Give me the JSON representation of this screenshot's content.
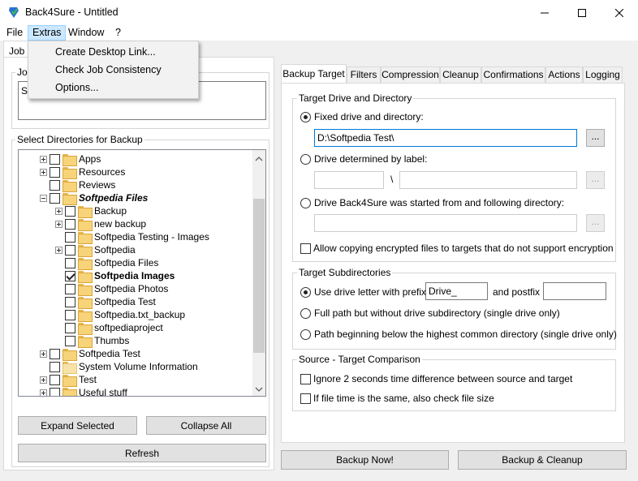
{
  "window": {
    "title": "Back4Sure - Untitled",
    "minimize": "—",
    "maximize": "☐",
    "close": "✕"
  },
  "menu": {
    "items": [
      "File",
      "Extras",
      "Window",
      "?"
    ],
    "extras_dropdown": [
      "Create Desktop Link...",
      "Check Job Consistency",
      "Options..."
    ]
  },
  "left": {
    "tab_label": "Job S",
    "job_group_label": "Jo",
    "job_text_value": "S",
    "dirs_label": "Select Directories for Backup",
    "tree": [
      {
        "label": "Apps",
        "exp": "plus",
        "checked": false
      },
      {
        "label": "Resources",
        "exp": "plus",
        "checked": false
      },
      {
        "label": "Reviews",
        "exp": "none",
        "checked": false
      },
      {
        "label": "Softpedia Files",
        "exp": "minus",
        "checked": false,
        "style": "italicbold"
      },
      {
        "label": "Backup",
        "exp": "plus",
        "checked": false
      },
      {
        "label": "new backup",
        "exp": "plus",
        "checked": false
      },
      {
        "label": "Softpedia Testing - Images",
        "exp": "none",
        "checked": false
      },
      {
        "label": "Softpedia",
        "exp": "plus",
        "checked": false
      },
      {
        "label": "Softpedia Files",
        "exp": "none",
        "checked": false
      },
      {
        "label": "Softpedia Images",
        "exp": "none",
        "checked": true,
        "style": "bold"
      },
      {
        "label": "Softpedia Photos",
        "exp": "none",
        "checked": false
      },
      {
        "label": "Softpedia Test",
        "exp": "none",
        "checked": false
      },
      {
        "label": "Softpedia.txt_backup",
        "exp": "none",
        "checked": false
      },
      {
        "label": "softpediaproject",
        "exp": "none",
        "checked": false
      },
      {
        "label": "Thumbs",
        "exp": "none",
        "checked": false
      },
      {
        "label": "Softpedia Test",
        "exp": "plus",
        "checked": false
      },
      {
        "label": "System Volume Information",
        "exp": "none",
        "checked": false,
        "sys": true
      },
      {
        "label": "Test",
        "exp": "plus",
        "checked": false
      },
      {
        "label": "Useful stuff",
        "exp": "plus",
        "checked": false
      }
    ],
    "expand_button": "Expand Selected",
    "collapse_button": "Collapse All",
    "refresh_button": "Refresh"
  },
  "right": {
    "tabs": [
      "Backup Target",
      "Filters",
      "Compression",
      "Cleanup",
      "Confirmations",
      "Actions",
      "Logging"
    ],
    "target_drive": {
      "label": "Target Drive and Directory",
      "opt_fixed": "Fixed drive and directory:",
      "fixed_value": "D:\\Softpedia Test\\",
      "browse": "...",
      "opt_label": "Drive determined by label:",
      "separator": "\\",
      "opt_started": "Drive Back4Sure was started from and following directory:",
      "allow_encrypted": "Allow copying encrypted files to targets that do not support encryption"
    },
    "subdirs": {
      "label": "Target Subdirectories",
      "opt_prefix": "Use drive letter with prefix",
      "prefix_value": "Drive_",
      "and_postfix": "and postfix",
      "opt_fullpath": "Full path but without drive subdirectory (single drive only)",
      "opt_common": "Path beginning below the highest common directory (single drive only)"
    },
    "comparison": {
      "label": "Source - Target Comparison",
      "ignore_2s": "Ignore 2 seconds time difference between source and target",
      "check_size": "If file time is the same, also check file size"
    },
    "backup_now": "Backup Now!",
    "backup_cleanup": "Backup & Cleanup"
  }
}
